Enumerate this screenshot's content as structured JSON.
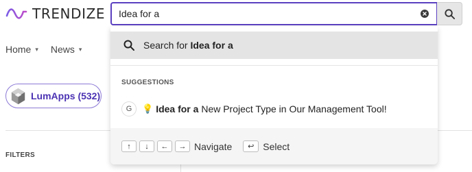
{
  "brand": {
    "name": "TRENDIZE"
  },
  "search": {
    "value": "Idea for a"
  },
  "nav": [
    {
      "label": "Home"
    },
    {
      "label": "News"
    }
  ],
  "chip": {
    "label": "LumApps (532)"
  },
  "filters": {
    "heading": "FILTERS"
  },
  "dropdown": {
    "search_for_prefix": "Search for ",
    "search_for_query": "Idea for a",
    "suggestions_heading": "SUGGESTIONS",
    "suggestion": {
      "source_icon": "G",
      "emoji": "💡",
      "bold": "Idea for a",
      "rest": " New Project Type in Our Management Tool!"
    },
    "footer": {
      "navigate_label": "Navigate",
      "select_label": "Select",
      "keys": [
        "↑",
        "↓",
        "←",
        "→"
      ],
      "enter_key": "↩"
    }
  },
  "colors": {
    "accent": "#5a3fc0",
    "chip_text": "#4b32b3"
  }
}
